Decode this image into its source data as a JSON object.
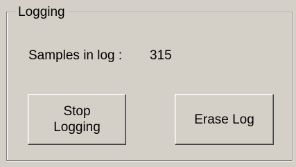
{
  "group": {
    "title": "Logging"
  },
  "samples": {
    "label": "Samples in log :",
    "value": "315"
  },
  "buttons": {
    "stop_label": "Stop\nLogging",
    "erase_label": "Erase Log"
  }
}
